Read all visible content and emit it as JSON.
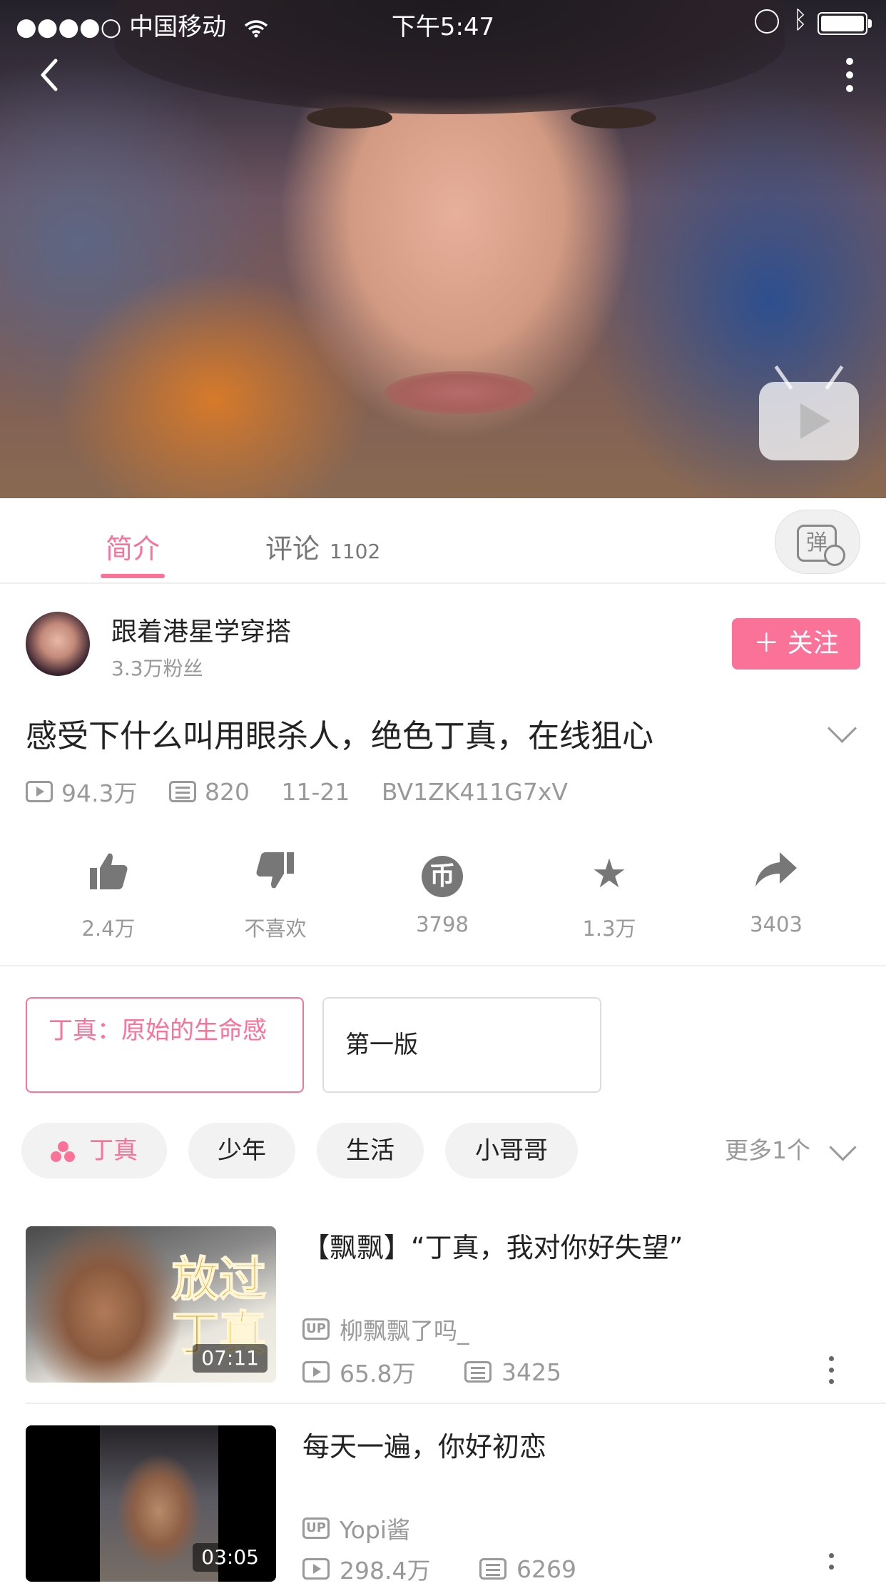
{
  "status_bar": {
    "signal": "●●●●○",
    "carrier": "中国移动",
    "time": "下午5:47"
  },
  "player": {
    "back_icon": "back-arrow-icon",
    "more_icon": "more-vertical-icon",
    "play_icon": "tv-play-icon"
  },
  "tabs": {
    "intro": "简介",
    "comments": "评论",
    "comments_count": "1102",
    "danmaku_glyph": "弹"
  },
  "uploader": {
    "name": "跟着港星学穿搭",
    "fans": "3.3万粉丝",
    "follow_label": "＋ 关注"
  },
  "video": {
    "title": "感受下什么叫用眼杀人，绝色丁真，在线狙心",
    "views": "94.3万",
    "danmaku": "820",
    "date": "11-21",
    "bvid": "BV1ZK411G7xV"
  },
  "actions": [
    {
      "icon": "thumbs-up-icon",
      "glyph": "👍",
      "label": "2.4万"
    },
    {
      "icon": "thumbs-down-icon",
      "glyph": "👎",
      "label": "不喜欢"
    },
    {
      "icon": "coin-icon",
      "glyph": "币",
      "label": "3798"
    },
    {
      "icon": "star-icon",
      "glyph": "★",
      "label": "1.3万"
    },
    {
      "icon": "share-icon",
      "glyph": "➦",
      "label": "3403"
    }
  ],
  "topics": {
    "primary": "丁真：原始的生命感",
    "secondary": "第一版"
  },
  "tags": {
    "items": [
      "丁真",
      "少年",
      "生活",
      "小哥哥"
    ],
    "more": "更多1个"
  },
  "related": [
    {
      "title": "【飘飘】“丁真，我对你好失望”",
      "overlay_text_1": "放过",
      "overlay_text_2": "丁真",
      "duration": "07:11",
      "up_badge": "UP",
      "uploader": "柳飘飘了吗_",
      "views": "65.8万",
      "danmaku": "3425"
    },
    {
      "title": "每天一遍，你好初恋",
      "duration": "03:05",
      "up_badge": "UP",
      "uploader": "Yopi酱",
      "views": "298.4万",
      "danmaku": "6269"
    }
  ],
  "colors": {
    "accent": "#fb7299",
    "muted_text": "#999999"
  }
}
